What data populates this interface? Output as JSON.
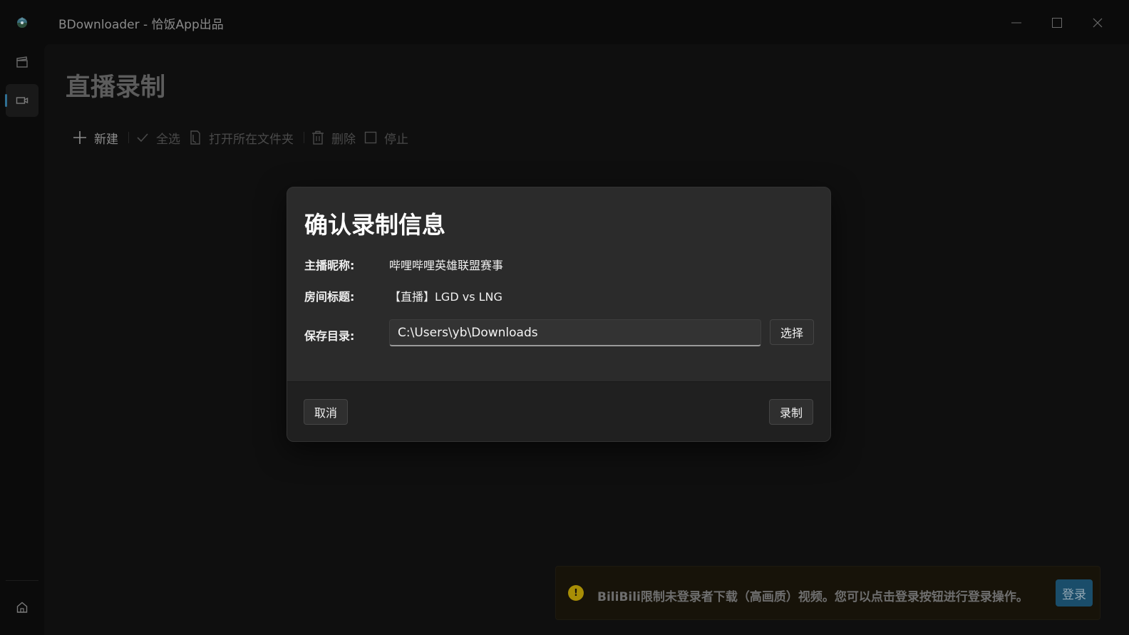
{
  "window": {
    "title": "BDownloader - 恰饭App出品"
  },
  "page": {
    "title": "直播录制"
  },
  "toolbar": {
    "new_label": "新建",
    "select_all_label": "全选",
    "open_folder_label": "打开所在文件夹",
    "delete_label": "删除",
    "stop_label": "停止"
  },
  "dialog": {
    "title": "确认录制信息",
    "streamer_label": "主播昵称:",
    "streamer_value": "哔哩哔哩英雄联盟赛事",
    "room_label": "房间标题:",
    "room_value": "【直播】LGD vs LNG",
    "save_dir_label": "保存目录:",
    "save_dir_value": "C:\\Users\\yb\\Downloads",
    "choose_label": "选择",
    "cancel_label": "取消",
    "record_label": "录制"
  },
  "infobar": {
    "icon": "warning-icon",
    "message": "BiliBili限制未登录者下载（高画质）视频。您可以点击登录按钮进行登录操作。",
    "login_label": "登录"
  },
  "colors": {
    "accent": "#2f6f93",
    "dialog_bg": "#2b2b2b",
    "warning": "#a88e06"
  }
}
